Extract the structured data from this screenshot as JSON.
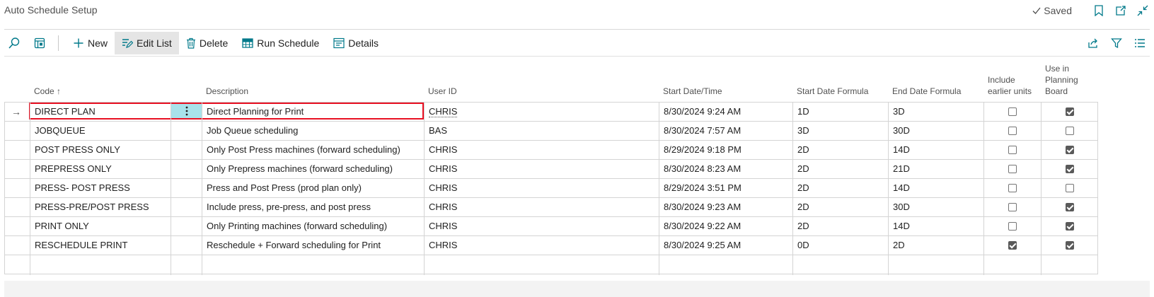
{
  "page": {
    "title": "Auto Schedule Setup",
    "saved_label": "Saved"
  },
  "toolbar": {
    "new_label": "New",
    "edit_list_label": "Edit List",
    "delete_label": "Delete",
    "run_schedule_label": "Run Schedule",
    "details_label": "Details"
  },
  "columns": {
    "code": "Code ↑",
    "description": "Description",
    "user_id": "User ID",
    "start_datetime": "Start Date/Time",
    "start_formula": "Start Date Formula",
    "end_formula": "End Date Formula",
    "include_earlier": "Include earlier units",
    "use_in_board": "Use in Planning Board"
  },
  "rows": [
    {
      "code": "DIRECT PLAN",
      "description": "Direct Planning for Print",
      "user_id": "CHRIS",
      "start_datetime": "8/30/2024 9:24 AM",
      "start_formula": "1D",
      "end_formula": "3D",
      "include_earlier": false,
      "use_in_board": true
    },
    {
      "code": "JOBQUEUE",
      "description": "Job Queue scheduling",
      "user_id": "BAS",
      "start_datetime": "8/30/2024 7:57 AM",
      "start_formula": "3D",
      "end_formula": "30D",
      "include_earlier": false,
      "use_in_board": false
    },
    {
      "code": "POST PRESS ONLY",
      "description": "Only Post Press machines (forward scheduling)",
      "user_id": "CHRIS",
      "start_datetime": "8/29/2024 9:18 PM",
      "start_formula": "2D",
      "end_formula": "14D",
      "include_earlier": false,
      "use_in_board": true
    },
    {
      "code": "PREPRESS ONLY",
      "description": "Only Prepress machines (forward scheduling)",
      "user_id": "CHRIS",
      "start_datetime": "8/30/2024 8:23 AM",
      "start_formula": "2D",
      "end_formula": "21D",
      "include_earlier": false,
      "use_in_board": true
    },
    {
      "code": "PRESS- POST PRESS",
      "description": "Press and Post Press (prod plan only)",
      "user_id": "CHRIS",
      "start_datetime": "8/29/2024 3:51 PM",
      "start_formula": "2D",
      "end_formula": "14D",
      "include_earlier": false,
      "use_in_board": false
    },
    {
      "code": "PRESS-PRE/POST PRESS",
      "description": "Include press, pre-press, and post press",
      "user_id": "CHRIS",
      "start_datetime": "8/30/2024 9:23 AM",
      "start_formula": "2D",
      "end_formula": "30D",
      "include_earlier": false,
      "use_in_board": true
    },
    {
      "code": "PRINT ONLY",
      "description": "Only Printing machines (forward scheduling)",
      "user_id": "CHRIS",
      "start_datetime": "8/30/2024 9:22 AM",
      "start_formula": "2D",
      "end_formula": "14D",
      "include_earlier": false,
      "use_in_board": true
    },
    {
      "code": "RESCHEDULE PRINT",
      "description": "Reschedule + Forward scheduling for Print",
      "user_id": "CHRIS",
      "start_datetime": "8/30/2024 9:25 AM",
      "start_formula": "0D",
      "end_formula": "2D",
      "include_earlier": true,
      "use_in_board": true
    }
  ],
  "icons": {
    "search": "search-icon",
    "layout": "layout-icon",
    "share": "share-icon",
    "filter": "filter-icon",
    "list": "list-view-icon",
    "bookmark": "bookmark-icon",
    "open_new": "open-new-window-icon",
    "collapse": "collapse-icon"
  },
  "colors": {
    "selection_border": "#e81123",
    "dots_highlight": "#a8e2ea",
    "accent": "#00798a"
  }
}
